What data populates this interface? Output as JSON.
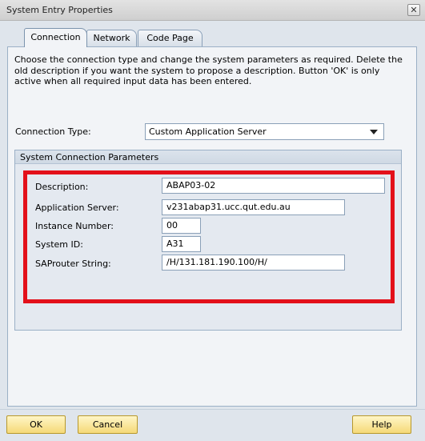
{
  "window": {
    "title": "System Entry Properties"
  },
  "tabs": [
    {
      "label": "Connection"
    },
    {
      "label": "Network"
    },
    {
      "label": "Code Page"
    }
  ],
  "instructions": "Choose the connection type and change the system parameters as required. Delete the old description if you want the system to propose a description. Button 'OK' is only active when all required input data has been entered.",
  "connection_type": {
    "label": "Connection Type:",
    "value": "Custom Application Server"
  },
  "group": {
    "title": "System Connection Parameters",
    "fields": [
      {
        "label": "Description:",
        "value": "ABAP03-02"
      },
      {
        "label": "Application Server:",
        "value": "v231abap31.ucc.qut.edu.au"
      },
      {
        "label": "Instance Number:",
        "value": "00"
      },
      {
        "label": "System ID:",
        "value": "A31"
      },
      {
        "label": "SAProuter String:",
        "value": "/H/131.181.190.100/H/"
      }
    ]
  },
  "buttons": {
    "ok": "OK",
    "cancel": "Cancel",
    "help": "Help"
  },
  "colors": {
    "highlight": "#e3101a",
    "button": "#f5d978"
  }
}
